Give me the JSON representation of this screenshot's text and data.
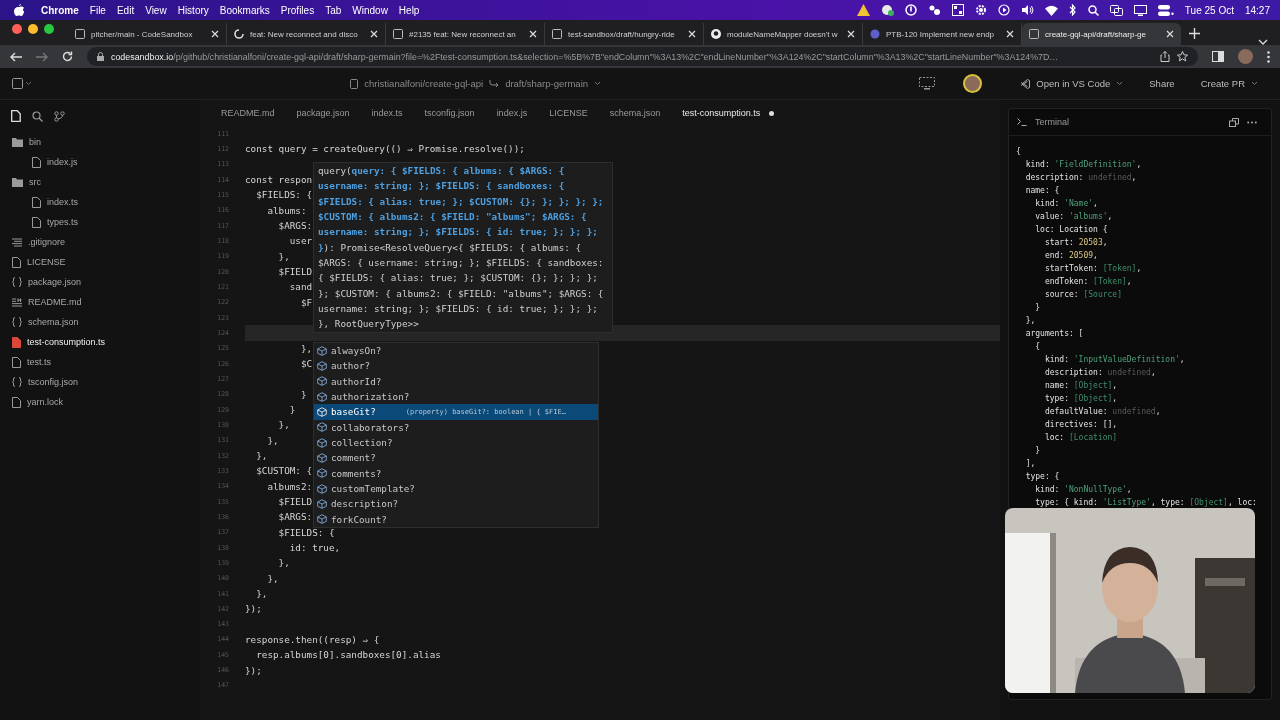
{
  "menu_bar": {
    "app": "Chrome",
    "items": [
      "File",
      "Edit",
      "View",
      "History",
      "Bookmarks",
      "Profiles",
      "Tab",
      "Window",
      "Help"
    ],
    "date": "Tue 25 Oct",
    "time": "14:27"
  },
  "browser": {
    "tabs": [
      {
        "title": "pitcher/main - CodeSandbox",
        "kind": "page",
        "selected": false
      },
      {
        "title": "feat: New reconnect and disco",
        "kind": "loading",
        "selected": false
      },
      {
        "title": "#2135 feat: New reconnect an",
        "kind": "page",
        "selected": false
      },
      {
        "title": "test-sandbox/draft/hungry-ride",
        "kind": "page",
        "selected": false
      },
      {
        "title": "moduleNameMapper doesn't w",
        "kind": "github",
        "selected": false
      },
      {
        "title": "PTB-120 Implement new endp",
        "kind": "circle",
        "selected": false
      },
      {
        "title": "create-gql-api/draft/sharp-ge",
        "kind": "page",
        "selected": true
      }
    ],
    "address": {
      "host": "codesandbox.io",
      "path": "/p/github/christianalfoni/create-gql-api/draft/sharp-germain?file=%2Ftest-consumption.ts&selection=%5B%7B\"endColumn\"%3A13%2C\"endLineNumber\"%3A124%2C\"startColumn\"%3A13%2C\"startLineNumber\"%3A124%7D…"
    }
  },
  "toolbar": {
    "repo": "christianalfoni/create-gql-api",
    "branch": "draft/sharp-germain",
    "open_in": "Open in VS Code",
    "share": "Share",
    "create_pr": "Create PR"
  },
  "explorer": {
    "items": [
      {
        "name": "bin",
        "kind": "folder",
        "selected": false,
        "children": [
          {
            "name": "index.js",
            "kind": "file",
            "selected": false
          }
        ]
      },
      {
        "name": "src",
        "kind": "folder",
        "selected": false,
        "children": [
          {
            "name": "index.ts",
            "kind": "file",
            "selected": false
          },
          {
            "name": "types.ts",
            "kind": "file",
            "selected": false
          }
        ]
      },
      {
        "name": ".gitignore",
        "kind": "lines",
        "selected": false
      },
      {
        "name": "LICENSE",
        "kind": "file",
        "selected": false
      },
      {
        "name": "package.json",
        "kind": "json",
        "selected": false
      },
      {
        "name": "README.md",
        "kind": "md",
        "selected": false
      },
      {
        "name": "schema.json",
        "kind": "json",
        "selected": false
      },
      {
        "name": "test-consumption.ts",
        "kind": "file",
        "selected": true
      },
      {
        "name": "test.ts",
        "kind": "file",
        "selected": false
      },
      {
        "name": "tsconfig.json",
        "kind": "json",
        "selected": false
      },
      {
        "name": "yarn.lock",
        "kind": "file",
        "selected": false
      }
    ]
  },
  "editor": {
    "tabs": [
      {
        "label": "README.md",
        "selected": false,
        "modified": false
      },
      {
        "label": "package.json",
        "selected": false,
        "modified": false
      },
      {
        "label": "index.ts",
        "selected": false,
        "modified": false
      },
      {
        "label": "tsconfig.json",
        "selected": false,
        "modified": false
      },
      {
        "label": "index.js",
        "selected": false,
        "modified": false
      },
      {
        "label": "LICENSE",
        "selected": false,
        "modified": false
      },
      {
        "label": "schema.json",
        "selected": false,
        "modified": false
      },
      {
        "label": "test-consumption.ts",
        "selected": true,
        "modified": true
      }
    ],
    "lines": [
      {
        "number": "111",
        "current": false
      },
      {
        "number": "112",
        "text": "const query = createQuery(() ⇒ Promise.resolve());",
        "current": false
      },
      {
        "number": "113",
        "current": false
      },
      {
        "number": "114",
        "text": "const respon",
        "current": false
      },
      {
        "number": "115",
        "text": "  $FIELDS: {",
        "current": false
      },
      {
        "number": "116",
        "text": "    albums:",
        "current": false
      },
      {
        "number": "117",
        "text": "      $ARGS:",
        "current": false
      },
      {
        "number": "118",
        "text": "        user",
        "current": false
      },
      {
        "number": "119",
        "text": "      },",
        "current": false
      },
      {
        "number": "120",
        "text": "      $FIELD",
        "current": false
      },
      {
        "number": "121",
        "text": "        sand",
        "current": false
      },
      {
        "number": "122",
        "text": "          $F",
        "current": false
      },
      {
        "number": "123",
        "current": false
      },
      {
        "number": "124",
        "current": true
      },
      {
        "number": "125",
        "text": "          },",
        "current": false
      },
      {
        "number": "126",
        "text": "          $C",
        "current": false
      },
      {
        "number": "127",
        "current": false
      },
      {
        "number": "128",
        "text": "          }",
        "current": false
      },
      {
        "number": "129",
        "text": "        }",
        "current": false
      },
      {
        "number": "130",
        "text": "      },",
        "current": false
      },
      {
        "number": "131",
        "text": "    },",
        "current": false
      },
      {
        "number": "132",
        "text": "  },",
        "current": false
      },
      {
        "number": "133",
        "text": "  $CUSTOM: {",
        "current": false
      },
      {
        "number": "134",
        "text": "    albums2:",
        "current": false
      },
      {
        "number": "135",
        "text": "      $FIELD",
        "current": false
      },
      {
        "number": "136",
        "text": "      $ARGS:",
        "current": false
      },
      {
        "number": "137",
        "text": "      $FIELDS: {",
        "current": false
      },
      {
        "number": "138",
        "text": "        id: true,",
        "current": false
      },
      {
        "number": "139",
        "text": "      },",
        "current": false
      },
      {
        "number": "140",
        "text": "    },",
        "current": false
      },
      {
        "number": "141",
        "text": "  },",
        "current": false
      },
      {
        "number": "142",
        "text": "});",
        "current": false
      },
      {
        "number": "143",
        "current": false
      },
      {
        "number": "144",
        "text": "response.then((resp) ⇒ {",
        "current": false
      },
      {
        "number": "145",
        "text": "  resp.albums[0].sandboxes[0].alias",
        "current": false
      },
      {
        "number": "146",
        "text": "});",
        "current": false
      },
      {
        "number": "147",
        "current": false
      }
    ],
    "hover": [
      [
        {
          "text": "query(",
          "param": false
        },
        {
          "text": "query: { $FIELDS: { albums: { $ARGS: {",
          "param": true
        }
      ],
      [
        {
          "text": "username: string; }; $FIELDS: { sandboxes: {",
          "param": true
        }
      ],
      [
        {
          "text": "$FIELDS: { alias: true; }; $CUSTOM: {}; }; }; }; };",
          "param": true
        }
      ],
      [
        {
          "text": "$CUSTOM: { albums2: { $FIELD: \"albums\"; $ARGS: {",
          "param": true
        }
      ],
      [
        {
          "text": "username: string; }; $FIELDS: { id: true; }; }; };",
          "param": true
        }
      ],
      [
        {
          "text": "}",
          "param": true
        },
        {
          "text": "): Promise<ResolveQuery<{ $FIELDS: { albums: {",
          "param": false
        }
      ],
      [
        {
          "text": "$ARGS: { username: string; }; $FIELDS: { sandboxes:",
          "param": false
        }
      ],
      [
        {
          "text": "{ $FIELDS: { alias: true; }; $CUSTOM: {}; }; }; };",
          "param": false
        }
      ],
      [
        {
          "text": "}; $CUSTOM: { albums2: { $FIELD: \"albums\"; $ARGS: {",
          "param": false
        }
      ],
      [
        {
          "text": "username: string; }; $FIELDS: { id: true; }; }; };",
          "param": false
        }
      ],
      [
        {
          "text": "}, RootQueryType>>",
          "param": false
        }
      ]
    ],
    "suggestions": [
      {
        "label": "alwaysOn?",
        "selected": false
      },
      {
        "label": "author?",
        "selected": false
      },
      {
        "label": "authorId?",
        "selected": false
      },
      {
        "label": "authorization?",
        "selected": false
      },
      {
        "label": "baseGit?",
        "selected": true,
        "detail": "(property) baseGit?: boolean | { $FIE…"
      },
      {
        "label": "collaborators?",
        "selected": false
      },
      {
        "label": "collection?",
        "selected": false
      },
      {
        "label": "comment?",
        "selected": false
      },
      {
        "label": "comments?",
        "selected": false
      },
      {
        "label": "customTemplate?",
        "selected": false
      },
      {
        "label": "description?",
        "selected": false
      },
      {
        "label": "forkCount?",
        "selected": false
      }
    ]
  },
  "terminal": {
    "title": "Terminal",
    "lines": [
      [
        {
          "text": "{",
          "kind": "plain"
        }
      ],
      [
        {
          "text": "  kind: ",
          "kind": "plain"
        },
        {
          "text": "'FieldDefinition'",
          "kind": "string"
        },
        {
          "text": ",",
          "kind": "plain"
        }
      ],
      [
        {
          "text": "  description: ",
          "kind": "plain"
        },
        {
          "text": "undefined",
          "kind": "undefined"
        },
        {
          "text": ",",
          "kind": "plain"
        }
      ],
      [
        {
          "text": "  name: {",
          "kind": "plain"
        }
      ],
      [
        {
          "text": "    kind: ",
          "kind": "plain"
        },
        {
          "text": "'Name'",
          "kind": "string"
        },
        {
          "text": ",",
          "kind": "plain"
        }
      ],
      [
        {
          "text": "    value: ",
          "kind": "plain"
        },
        {
          "text": "'albums'",
          "kind": "string"
        },
        {
          "text": ",",
          "kind": "plain"
        }
      ],
      [
        {
          "text": "    loc: Location {",
          "kind": "plain"
        }
      ],
      [
        {
          "text": "      start: ",
          "kind": "plain"
        },
        {
          "text": "20503",
          "kind": "number"
        },
        {
          "text": ",",
          "kind": "plain"
        }
      ],
      [
        {
          "text": "      end: ",
          "kind": "plain"
        },
        {
          "text": "20509",
          "kind": "number"
        },
        {
          "text": ",",
          "kind": "plain"
        }
      ],
      [
        {
          "text": "      startToken: ",
          "kind": "plain"
        },
        {
          "text": "[Token]",
          "kind": "ref"
        },
        {
          "text": ",",
          "kind": "plain"
        }
      ],
      [
        {
          "text": "      endToken: ",
          "kind": "plain"
        },
        {
          "text": "[Token]",
          "kind": "ref"
        },
        {
          "text": ",",
          "kind": "plain"
        }
      ],
      [
        {
          "text": "      source: ",
          "kind": "plain"
        },
        {
          "text": "[Source]",
          "kind": "ref"
        }
      ],
      [
        {
          "text": "    }",
          "kind": "plain"
        }
      ],
      [
        {
          "text": "  },",
          "kind": "plain"
        }
      ],
      [
        {
          "text": "  arguments: [",
          "kind": "plain"
        }
      ],
      [
        {
          "text": "    {",
          "kind": "plain"
        }
      ],
      [
        {
          "text": "      kind: ",
          "kind": "plain"
        },
        {
          "text": "'InputValueDefinition'",
          "kind": "string"
        },
        {
          "text": ",",
          "kind": "plain"
        }
      ],
      [
        {
          "text": "      description: ",
          "kind": "plain"
        },
        {
          "text": "undefined",
          "kind": "undefined"
        },
        {
          "text": ",",
          "kind": "plain"
        }
      ],
      [
        {
          "text": "      name: ",
          "kind": "plain"
        },
        {
          "text": "[Object]",
          "kind": "ref"
        },
        {
          "text": ",",
          "kind": "plain"
        }
      ],
      [
        {
          "text": "      type: ",
          "kind": "plain"
        },
        {
          "text": "[Object]",
          "kind": "ref"
        },
        {
          "text": ",",
          "kind": "plain"
        }
      ],
      [
        {
          "text": "      defaultValue: ",
          "kind": "plain"
        },
        {
          "text": "undefined",
          "kind": "undefined"
        },
        {
          "text": ",",
          "kind": "plain"
        }
      ],
      [
        {
          "text": "      directives: [],",
          "kind": "plain"
        }
      ],
      [
        {
          "text": "      loc: ",
          "kind": "plain"
        },
        {
          "text": "[Location]",
          "kind": "ref"
        }
      ],
      [
        {
          "text": "    }",
          "kind": "plain"
        }
      ],
      [
        {
          "text": "  ],",
          "kind": "plain"
        }
      ],
      [
        {
          "text": "  type: {",
          "kind": "plain"
        }
      ],
      [
        {
          "text": "    kind: ",
          "kind": "plain"
        },
        {
          "text": "'NonNullType'",
          "kind": "string"
        },
        {
          "text": ",",
          "kind": "plain"
        }
      ],
      [
        {
          "text": "    type: { kind: ",
          "kind": "plain"
        },
        {
          "text": "'ListType'",
          "kind": "string"
        },
        {
          "text": ", type: ",
          "kind": "plain"
        },
        {
          "text": "[Object]",
          "kind": "ref"
        },
        {
          "text": ", loc:",
          "kind": "plain"
        }
      ]
    ]
  }
}
